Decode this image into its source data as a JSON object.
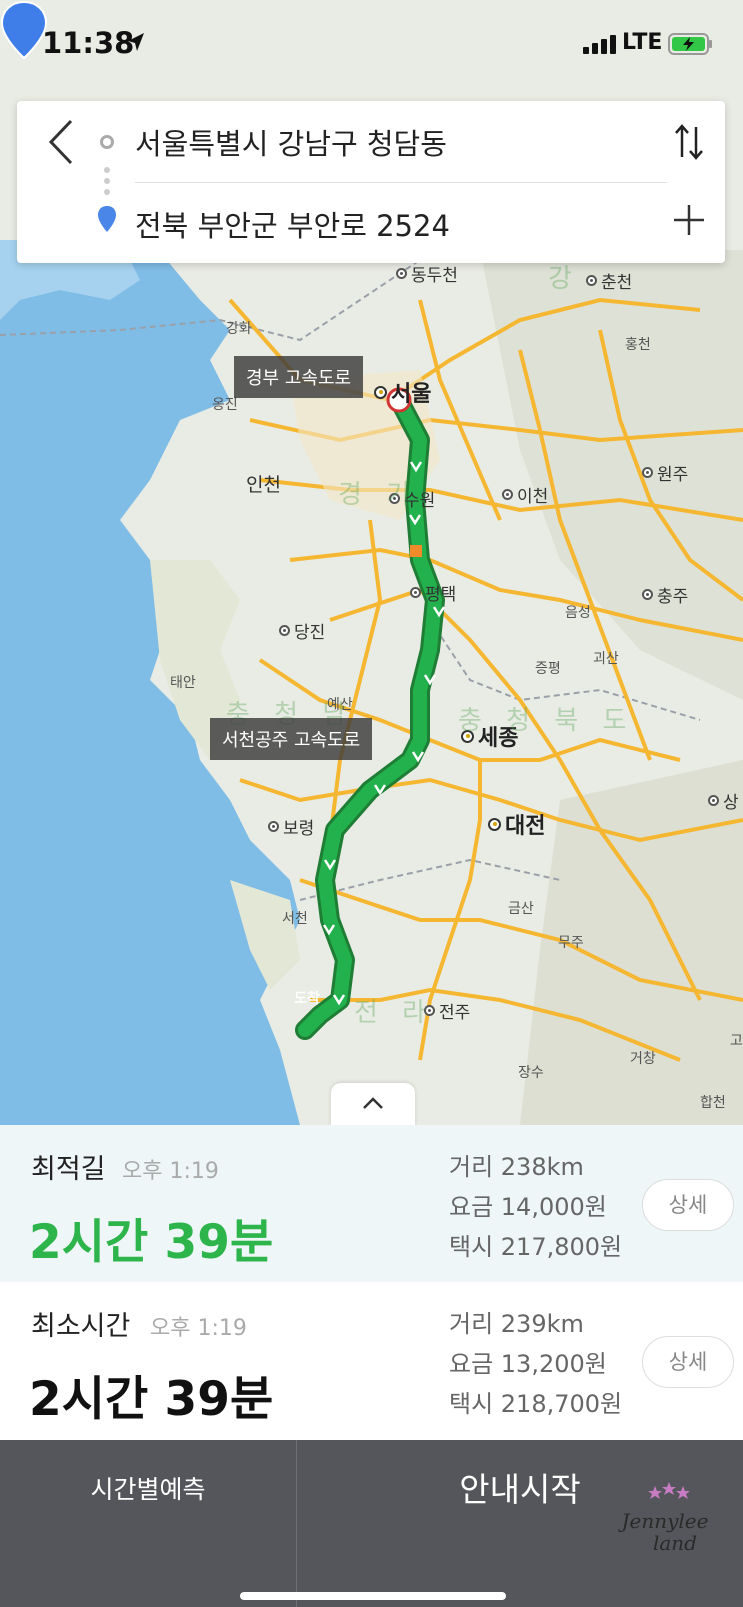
{
  "status_bar": {
    "time": "11:38",
    "network": "LTE"
  },
  "search": {
    "origin": "서울특별시 강남구 청담동",
    "destination": "전북 부안군 부안로 2524"
  },
  "map": {
    "cities": [
      {
        "name": "동두천"
      },
      {
        "name": "춘천"
      },
      {
        "name": "서울"
      },
      {
        "name": "원주"
      },
      {
        "name": "수원"
      },
      {
        "name": "이천"
      },
      {
        "name": "평택"
      },
      {
        "name": "충주"
      },
      {
        "name": "당진"
      },
      {
        "name": "세종"
      },
      {
        "name": "대전"
      },
      {
        "name": "보령"
      },
      {
        "name": "전주"
      },
      {
        "name": "상"
      }
    ],
    "places": [
      "강화",
      "홍천",
      "옹진",
      "인천",
      "음성",
      "괴산",
      "증평",
      "태안",
      "예산",
      "서천",
      "금산",
      "무주",
      "장수",
      "거창",
      "합천",
      "고"
    ],
    "regions": [
      "강",
      "경 기",
      "충 청 남",
      "충 청 북 도",
      "전 라"
    ],
    "road_labels": [
      "경부 고속도로",
      "서천공주 고속도로"
    ],
    "arrive_label": "도착",
    "route_color": "#22b14c"
  },
  "routes": [
    {
      "name": "최적길",
      "arrival": "오후 1:19",
      "duration": "2시간 39분",
      "distance": "거리 238km",
      "toll": "요금 14,000원",
      "taxi": "택시 217,800원",
      "detail": "상세"
    },
    {
      "name": "최소시간",
      "arrival": "오후 1:19",
      "duration": "2시간 39분",
      "distance": "거리 239km",
      "toll": "요금 13,200원",
      "taxi": "택시 218,700원",
      "detail": "상세"
    }
  ],
  "bottom": {
    "predict": "시간별예측",
    "start": "안내시작",
    "watermark": "Jennylee land"
  }
}
